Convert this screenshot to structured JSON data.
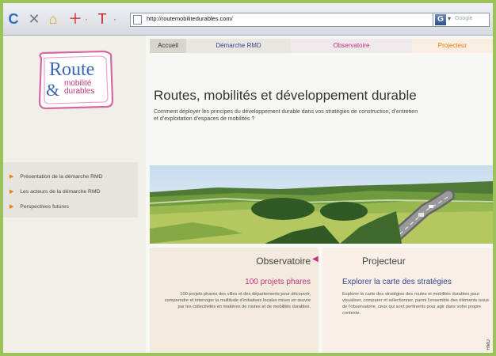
{
  "browser": {
    "url": "http://routemobilitedurables.com/",
    "search_placeholder": "Google",
    "buttons": [
      "back",
      "stop",
      "home",
      "plus",
      "text"
    ]
  },
  "logo": {
    "line1": "Route",
    "amp": "&",
    "line2": "mobilité",
    "line3": "durables"
  },
  "sidebar": {
    "items": [
      "Présentation de la démarche RMD",
      "Les acteurs de la démarche RMD",
      "Perspectives futures"
    ]
  },
  "nav": {
    "tabs": [
      "Accueil",
      "Démarche RMD",
      "Observatoire",
      "Projecteur"
    ]
  },
  "main": {
    "title": "Routes, mobilités et développement durable",
    "subtitle": "Comment déployer les principes du développement durable dans vos stratégies de construction, d’entretien et d’exploitation d’espaces de mobilités ?",
    "observatoire": {
      "title": "Observatoire",
      "subtitle": "100 projets phares",
      "body": "100 projets phares des villes et des départements pour découvrir, comprendre et interroger la multitude d’initiatives locales mises en œuvre par les collectivités en matières de routes et de mobilités durables."
    },
    "projecteur": {
      "title": "Projecteur",
      "subtitle": "Explorer la carte des stratégies",
      "body": "Explorer la carte des stratégies des routes et mobilités durables pour visualiser, comparer et sélectionner, parmi l’ensemble des éléments issus de l’observatoire, ceux qui sont pertinents pour agir dans votre propre contexte."
    }
  },
  "credit": "RMD",
  "colors": {
    "accent_blue": "#3b66b8",
    "accent_pink": "#c2357f",
    "accent_orange": "#f07b12"
  }
}
